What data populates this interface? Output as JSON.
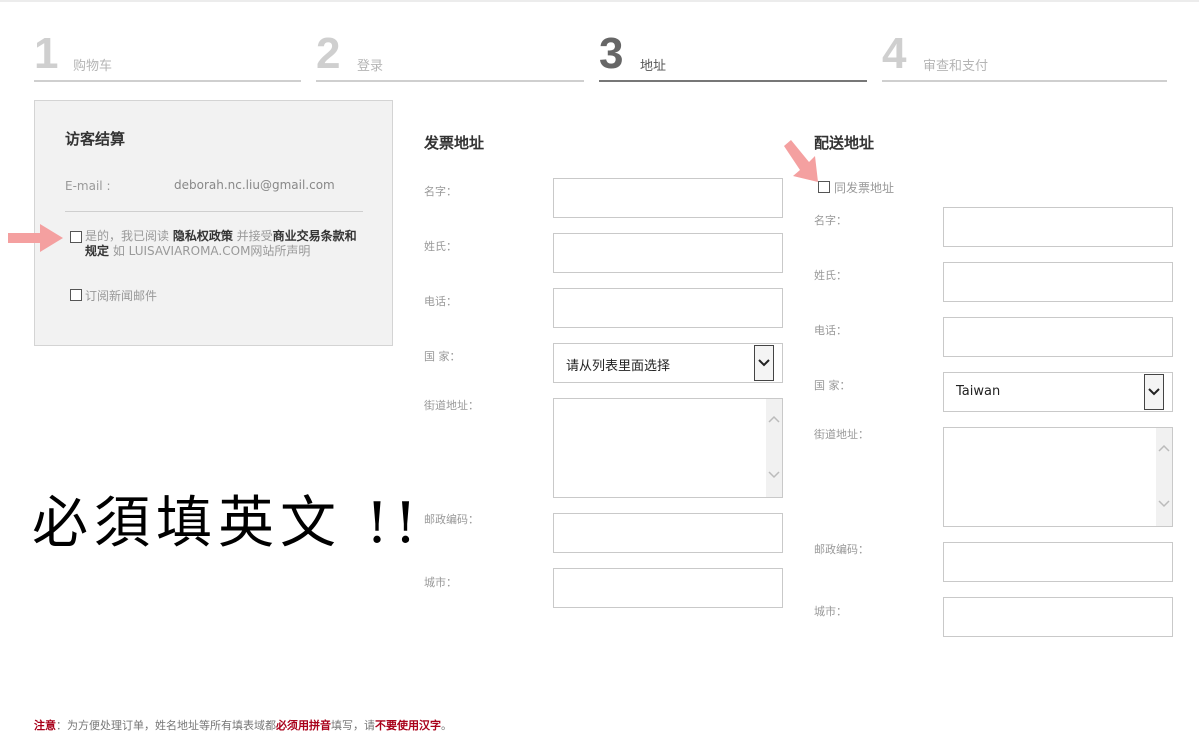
{
  "steps": [
    {
      "number": "1",
      "label": "购物车"
    },
    {
      "number": "2",
      "label": "登录"
    },
    {
      "number": "3",
      "label": "地址"
    },
    {
      "number": "4",
      "label": "审查和支付"
    }
  ],
  "guest": {
    "title": "访客结算",
    "email_label": "E-mail :",
    "email_value": "deborah.nc.liu@gmail.com",
    "terms": {
      "part1": "是的，我已阅读 ",
      "privacy": "隐私权政策",
      "part2": " 并接受",
      "commerce": "商业交易条款和规定",
      "part3": " 如 LUISAVIAROMA.COM网站所声明"
    },
    "newsletter": "订阅新闻邮件"
  },
  "note_big": "必須填英文 !!",
  "billing": {
    "title": "发票地址",
    "first_name": "名字：",
    "last_name": "姓氏：",
    "phone": "电话：",
    "country": "国 家：",
    "country_value": "请从列表里面选择",
    "street": "街道地址：",
    "zip": "邮政编码：",
    "city": "城市："
  },
  "shipping": {
    "title": "配送地址",
    "same_as_billing": "同发票地址",
    "first_name": "名字：",
    "last_name": "姓氏：",
    "phone": "电话：",
    "country": "国 家：",
    "country_value": "Taiwan",
    "street": "街道地址：",
    "zip": "邮政编码：",
    "city": "城市："
  },
  "footer": {
    "prefix": "注意",
    "part1": "：为方便处理订单，姓名地址等所有填表域都",
    "must_pinyin": "必须用拼音",
    "part2": "填写，请",
    "no_hanzi": "不要使用汉字",
    "part3": "。"
  },
  "colors": {
    "arrow": "#f4a0a0",
    "accent_red": "#a8001a",
    "panel_bg": "#f2f2f2"
  },
  "icons": [
    "arrow-right-icon",
    "arrow-down-right-icon",
    "chevron-down-icon",
    "chevron-up-icon"
  ]
}
